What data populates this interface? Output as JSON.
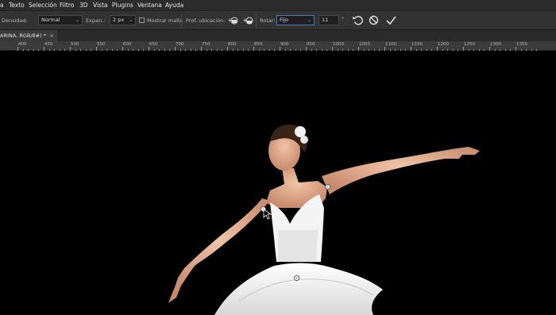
{
  "menu": [
    "a",
    "Texto",
    "Selección",
    "Filtro",
    "3D",
    "Vista",
    "Plugins",
    "Ventana",
    "Ayuda"
  ],
  "options": {
    "density_label": "Densidad:",
    "density_value": "Normal",
    "expansion_label": "Expan.:",
    "expansion_value": "2 px",
    "show_mesh_label": "Mostrar malla",
    "pin_depth_label": "Prof. ubicación:",
    "rotate_label": "Rotar:",
    "rotate_mode": "Fijo",
    "rotate_angle": "11",
    "degree_symbol": "°"
  },
  "document_tab": {
    "title": "ARINA, RGB/8#) *",
    "close": "×"
  },
  "ruler": [
    "400",
    "450",
    "500",
    "550",
    "600",
    "650",
    "700",
    "750",
    "800",
    "850",
    "900",
    "950",
    "1000",
    "1050",
    "1100",
    "1150",
    "1200",
    "1250",
    "1300",
    "1350"
  ],
  "colors": {
    "menubar": "#2b2b2b",
    "options_bar": "#323232",
    "canvas": "#000000",
    "accent": "#4a7ac4"
  }
}
